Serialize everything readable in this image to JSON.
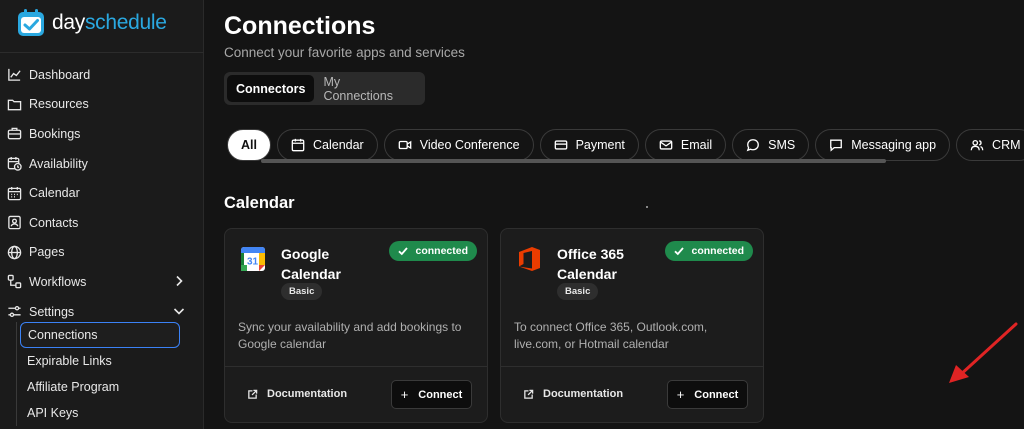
{
  "brand": {
    "name_part1": "day",
    "name_part2": "schedule"
  },
  "sidebar": {
    "items": [
      {
        "label": "Dashboard",
        "icon": "chart-line-icon"
      },
      {
        "label": "Resources",
        "icon": "folder-icon"
      },
      {
        "label": "Bookings",
        "icon": "briefcase-icon"
      },
      {
        "label": "Availability",
        "icon": "calendar-clock-icon"
      },
      {
        "label": "Calendar",
        "icon": "calendar-icon"
      },
      {
        "label": "Contacts",
        "icon": "contact-card-icon"
      },
      {
        "label": "Pages",
        "icon": "globe-icon"
      },
      {
        "label": "Workflows",
        "icon": "workflow-icon"
      },
      {
        "label": "Settings",
        "icon": "sliders-icon"
      }
    ],
    "settings_sub": [
      {
        "label": "Connections"
      },
      {
        "label": "Expirable Links"
      },
      {
        "label": "Affiliate Program"
      },
      {
        "label": "API Keys"
      }
    ]
  },
  "main": {
    "title": "Connections",
    "subtitle": "Connect your favorite apps and services",
    "tabs": [
      {
        "label": "Connectors"
      },
      {
        "label": "My Connections"
      }
    ],
    "filters": [
      {
        "label": "All",
        "icon": ""
      },
      {
        "label": "Calendar",
        "icon": "calendar-icon"
      },
      {
        "label": "Video Conference",
        "icon": "video-icon"
      },
      {
        "label": "Payment",
        "icon": "credit-card-icon"
      },
      {
        "label": "Email",
        "icon": "mail-icon"
      },
      {
        "label": "SMS",
        "icon": "message-circle-icon"
      },
      {
        "label": "Messaging app",
        "icon": "message-square-icon"
      },
      {
        "label": "CRM",
        "icon": "users-icon"
      }
    ],
    "section_title": "Calendar",
    "cards": [
      {
        "name": "Google Calendar",
        "tier": "Basic",
        "status": "connected",
        "description": "Sync your availability and add bookings to Google calendar",
        "doc_label": "Documentation",
        "connect_label": "Connect",
        "icon": "google-calendar-icon"
      },
      {
        "name": "Office 365 Calendar",
        "tier": "Basic",
        "status": "connected",
        "description": "To connect Office 365, Outlook.com, live.com, or Hotmail calendar",
        "doc_label": "Documentation",
        "connect_label": "Connect",
        "icon": "office-365-icon"
      }
    ]
  },
  "colors": {
    "background": "#141414",
    "sidebar": "#1b1b1b",
    "accent_blue": "#3b82f6",
    "brand_blue": "#2aa8e0",
    "connected_green": "#1f8a4c",
    "arrow_red": "#e02424"
  }
}
